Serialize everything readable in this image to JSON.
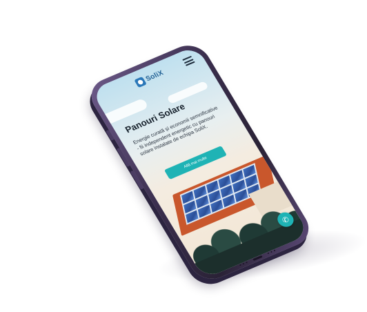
{
  "site": {
    "logo_text": "SoliX",
    "logo_icon": "solix-logo-mark",
    "menu_icon": "hamburger-menu-icon"
  },
  "hero": {
    "title": "Panouri Solare",
    "description": "Energie curată și economii semnificative - fii independent energetic cu panouri solare instalate de echipa SoliX.",
    "cta_label": "Află mai multe"
  },
  "fab": {
    "icon": "phone-icon",
    "glyph": "✆"
  },
  "colors": {
    "accent": "#1fb3b5",
    "brand": "#2a77b8",
    "phone_frame": "#3a2e4d"
  }
}
